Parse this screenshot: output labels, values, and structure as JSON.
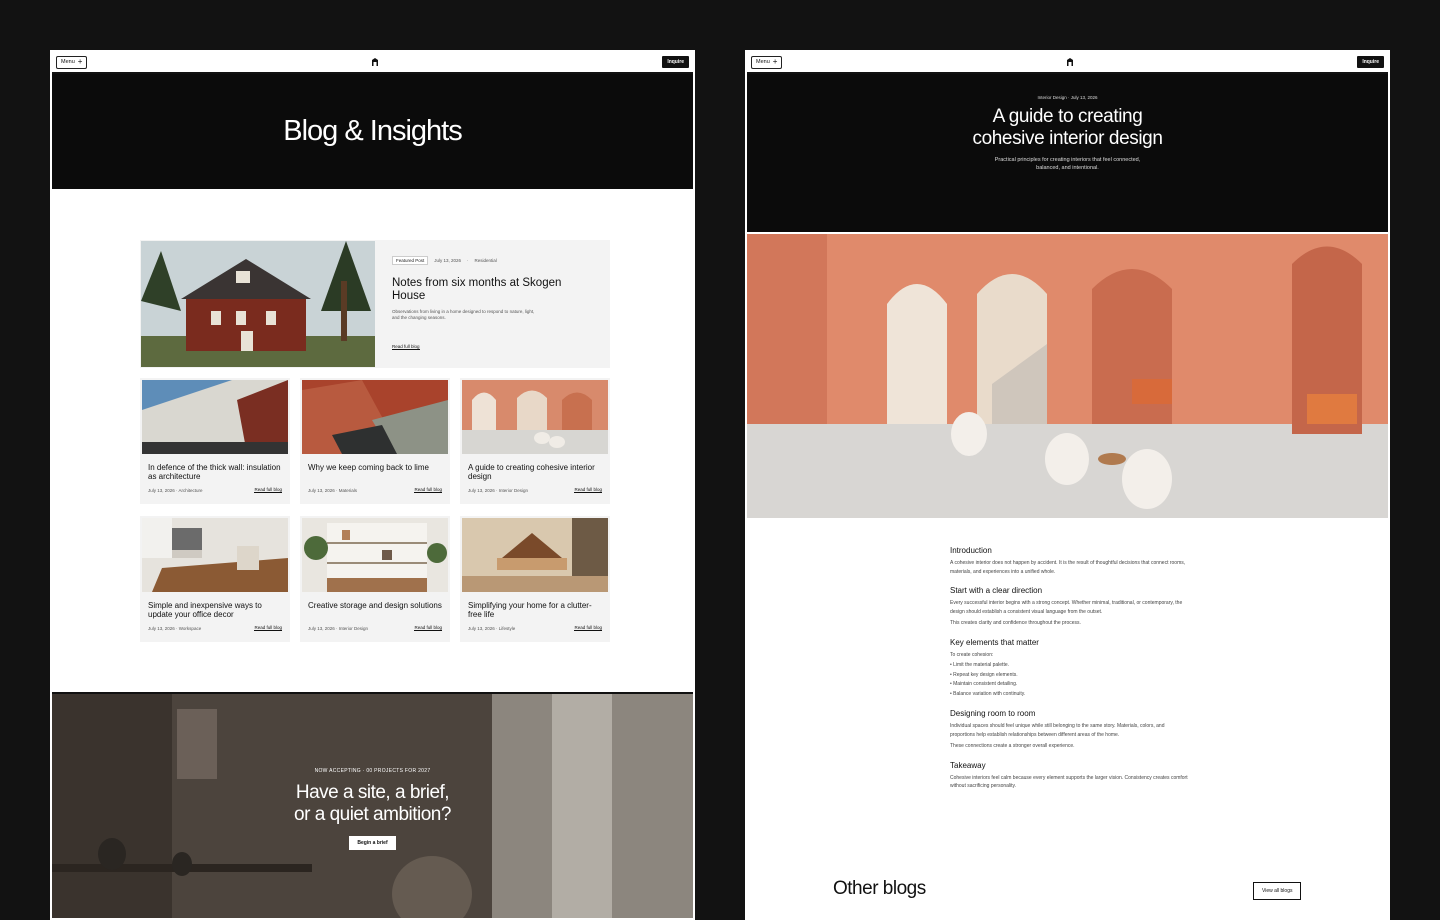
{
  "nav": {
    "menu_label": "Menu",
    "inquire_label": "Inquire"
  },
  "blog": {
    "title": "Blog & Insights",
    "featured": {
      "badge": "Featured Post",
      "date": "July 13, 2026",
      "category": "Residential",
      "title": "Notes from six months at Skogen House",
      "excerpt": "Observations from living in a home designed to respond to nature, light, and the changing seasons.",
      "link": "Read full blog"
    },
    "cards": [
      {
        "title": "In defence of the thick wall: insulation as architecture",
        "meta": "July 13, 2026 · Architecture",
        "link": "Read full blog"
      },
      {
        "title": "Why we keep coming back to lime",
        "meta": "July 13, 2026 · Materials",
        "link": "Read full blog"
      },
      {
        "title": "A guide to creating cohesive interior design",
        "meta": "July 13, 2026 · Interior Design",
        "link": "Read full blog"
      },
      {
        "title": "Simple and inexpensive ways to update your office decor",
        "meta": "July 13, 2026 · Workspace",
        "link": "Read full blog"
      },
      {
        "title": "Creative storage and design solutions",
        "meta": "July 13, 2026 · Interior Design",
        "link": "Read full blog"
      },
      {
        "title": "Simplifying your home for a clutter-free life",
        "meta": "July 13, 2026 · Lifestyle",
        "link": "Read full blog"
      }
    ],
    "cta": {
      "eyebrow": "NOW ACCEPTING · 00 PROJECTS FOR 2027",
      "title_line1": "Have a site, a brief,",
      "title_line2": "or a quiet ambition?",
      "button": "Begin a brief"
    }
  },
  "article": {
    "category": "Interior Design",
    "date": "July 13, 2026",
    "title_line1": "A guide to creating",
    "title_line2": "cohesive interior design",
    "subtitle_line1": "Practical principles for creating interiors that feel connected,",
    "subtitle_line2": "balanced, and intentional.",
    "sections": {
      "intro_h": "Introduction",
      "intro_p": "A cohesive interior does not happen by accident. It is the result of thoughtful decisions that connect rooms, materials, and experiences into a unified whole.",
      "direction_h": "Start with a clear direction",
      "direction_p1": "Every successful interior begins with a strong concept. Whether minimal, traditional, or contemporary, the design should establish a consistent visual language from the outset.",
      "direction_p2": "This creates clarity and confidence throughout the process.",
      "key_h": "Key elements that matter",
      "key_p": "To create cohesion:",
      "key_list": [
        "Limit the material palette.",
        "Repeat key design elements.",
        "Maintain consistent detailing.",
        "Balance variation with continuity."
      ],
      "room_h": "Designing room to room",
      "room_p1": "Individual spaces should feel unique while still belonging to the same story. Materials, colors, and proportions help establish relationships between different areas of the home.",
      "room_p2": "These connections create a stronger overall experience.",
      "take_h": "Takeaway",
      "take_p": "Cohesive interiors feel calm because every element supports the larger vision. Consistency creates comfort without sacrificing personality."
    },
    "other_blogs": "Other blogs",
    "view_all": "View all blogs"
  }
}
